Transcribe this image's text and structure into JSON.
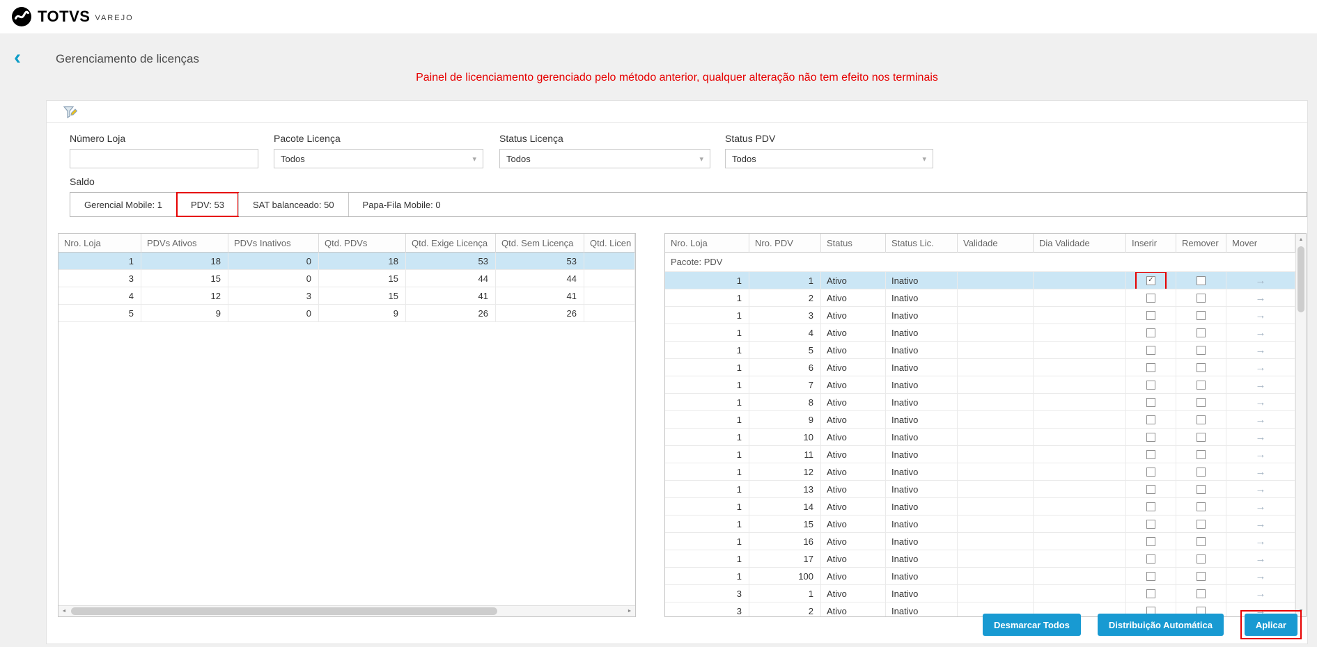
{
  "header": {
    "brand": "TOTVS",
    "brand_sub": "VAREJO"
  },
  "page": {
    "title": "Gerenciamento de licenças",
    "warning": "Painel de licenciamento gerenciado pelo método anterior, qualquer alteração não tem efeito nos terminais"
  },
  "filters": {
    "numero_loja": {
      "label": "Número Loja",
      "value": ""
    },
    "pacote_licenca": {
      "label": "Pacote Licença",
      "value": "Todos"
    },
    "status_licenca": {
      "label": "Status Licença",
      "value": "Todos"
    },
    "status_pdv": {
      "label": "Status PDV",
      "value": "Todos"
    }
  },
  "saldo": {
    "label": "Saldo",
    "items": [
      {
        "label": "Gerencial Mobile: 1",
        "annotated": false
      },
      {
        "label": "PDV: 53",
        "annotated": true
      },
      {
        "label": "SAT balanceado: 50",
        "annotated": false
      },
      {
        "label": "Papa-Fila Mobile: 0",
        "annotated": false
      }
    ]
  },
  "stores_table": {
    "columns": [
      "Nro. Loja",
      "PDVs Ativos",
      "PDVs Inativos",
      "Qtd. PDVs",
      "Qtd. Exige Licença",
      "Qtd. Sem Licença",
      "Qtd. Licen"
    ],
    "rows": [
      {
        "selected": true,
        "values": [
          "1",
          "18",
          "0",
          "18",
          "53",
          "53",
          ""
        ]
      },
      {
        "selected": false,
        "values": [
          "3",
          "15",
          "0",
          "15",
          "44",
          "44",
          ""
        ]
      },
      {
        "selected": false,
        "values": [
          "4",
          "12",
          "3",
          "15",
          "41",
          "41",
          ""
        ]
      },
      {
        "selected": false,
        "values": [
          "5",
          "9",
          "0",
          "9",
          "26",
          "26",
          ""
        ]
      }
    ]
  },
  "pdv_table": {
    "columns": [
      "Nro. Loja",
      "Nro. PDV",
      "Status",
      "Status Lic.",
      "Validade",
      "Dia Validade",
      "Inserir",
      "Remover",
      "Mover"
    ],
    "group_label": "Pacote: PDV",
    "rows": [
      {
        "loja": "1",
        "pdv": "1",
        "status": "Ativo",
        "status_lic": "Inativo",
        "validade": "",
        "dia_validade": "",
        "inserir": true,
        "remover": false,
        "selected": true,
        "annotated": true
      },
      {
        "loja": "1",
        "pdv": "2",
        "status": "Ativo",
        "status_lic": "Inativo",
        "validade": "",
        "dia_validade": "",
        "inserir": false,
        "remover": false,
        "selected": false,
        "annotated": false
      },
      {
        "loja": "1",
        "pdv": "3",
        "status": "Ativo",
        "status_lic": "Inativo",
        "validade": "",
        "dia_validade": "",
        "inserir": false,
        "remover": false,
        "selected": false,
        "annotated": false
      },
      {
        "loja": "1",
        "pdv": "4",
        "status": "Ativo",
        "status_lic": "Inativo",
        "validade": "",
        "dia_validade": "",
        "inserir": false,
        "remover": false,
        "selected": false,
        "annotated": false
      },
      {
        "loja": "1",
        "pdv": "5",
        "status": "Ativo",
        "status_lic": "Inativo",
        "validade": "",
        "dia_validade": "",
        "inserir": false,
        "remover": false,
        "selected": false,
        "annotated": false
      },
      {
        "loja": "1",
        "pdv": "6",
        "status": "Ativo",
        "status_lic": "Inativo",
        "validade": "",
        "dia_validade": "",
        "inserir": false,
        "remover": false,
        "selected": false,
        "annotated": false
      },
      {
        "loja": "1",
        "pdv": "7",
        "status": "Ativo",
        "status_lic": "Inativo",
        "validade": "",
        "dia_validade": "",
        "inserir": false,
        "remover": false,
        "selected": false,
        "annotated": false
      },
      {
        "loja": "1",
        "pdv": "8",
        "status": "Ativo",
        "status_lic": "Inativo",
        "validade": "",
        "dia_validade": "",
        "inserir": false,
        "remover": false,
        "selected": false,
        "annotated": false
      },
      {
        "loja": "1",
        "pdv": "9",
        "status": "Ativo",
        "status_lic": "Inativo",
        "validade": "",
        "dia_validade": "",
        "inserir": false,
        "remover": false,
        "selected": false,
        "annotated": false
      },
      {
        "loja": "1",
        "pdv": "10",
        "status": "Ativo",
        "status_lic": "Inativo",
        "validade": "",
        "dia_validade": "",
        "inserir": false,
        "remover": false,
        "selected": false,
        "annotated": false
      },
      {
        "loja": "1",
        "pdv": "11",
        "status": "Ativo",
        "status_lic": "Inativo",
        "validade": "",
        "dia_validade": "",
        "inserir": false,
        "remover": false,
        "selected": false,
        "annotated": false
      },
      {
        "loja": "1",
        "pdv": "12",
        "status": "Ativo",
        "status_lic": "Inativo",
        "validade": "",
        "dia_validade": "",
        "inserir": false,
        "remover": false,
        "selected": false,
        "annotated": false
      },
      {
        "loja": "1",
        "pdv": "13",
        "status": "Ativo",
        "status_lic": "Inativo",
        "validade": "",
        "dia_validade": "",
        "inserir": false,
        "remover": false,
        "selected": false,
        "annotated": false
      },
      {
        "loja": "1",
        "pdv": "14",
        "status": "Ativo",
        "status_lic": "Inativo",
        "validade": "",
        "dia_validade": "",
        "inserir": false,
        "remover": false,
        "selected": false,
        "annotated": false
      },
      {
        "loja": "1",
        "pdv": "15",
        "status": "Ativo",
        "status_lic": "Inativo",
        "validade": "",
        "dia_validade": "",
        "inserir": false,
        "remover": false,
        "selected": false,
        "annotated": false
      },
      {
        "loja": "1",
        "pdv": "16",
        "status": "Ativo",
        "status_lic": "Inativo",
        "validade": "",
        "dia_validade": "",
        "inserir": false,
        "remover": false,
        "selected": false,
        "annotated": false
      },
      {
        "loja": "1",
        "pdv": "17",
        "status": "Ativo",
        "status_lic": "Inativo",
        "validade": "",
        "dia_validade": "",
        "inserir": false,
        "remover": false,
        "selected": false,
        "annotated": false
      },
      {
        "loja": "1",
        "pdv": "100",
        "status": "Ativo",
        "status_lic": "Inativo",
        "validade": "",
        "dia_validade": "",
        "inserir": false,
        "remover": false,
        "selected": false,
        "annotated": false
      },
      {
        "loja": "3",
        "pdv": "1",
        "status": "Ativo",
        "status_lic": "Inativo",
        "validade": "",
        "dia_validade": "",
        "inserir": false,
        "remover": false,
        "selected": false,
        "annotated": false
      },
      {
        "loja": "3",
        "pdv": "2",
        "status": "Ativo",
        "status_lic": "Inativo",
        "validade": "",
        "dia_validade": "",
        "inserir": false,
        "remover": false,
        "selected": false,
        "annotated": false
      }
    ]
  },
  "actions": {
    "desmarcar": "Desmarcar Todos",
    "distribuicao": "Distribuição Automática",
    "aplicar": "Aplicar"
  },
  "icons": {
    "back": "‹",
    "chevron_down": "▾",
    "check": "✓",
    "arrow_right": "→",
    "scroll_left": "◄",
    "scroll_right": "►",
    "scroll_up": "▲",
    "scroll_down": "▼"
  },
  "colors": {
    "accent_blue": "#189ad2",
    "annotation_red": "#e60000",
    "warning_red": "#e60000",
    "selected_row": "#cbe6f5"
  }
}
